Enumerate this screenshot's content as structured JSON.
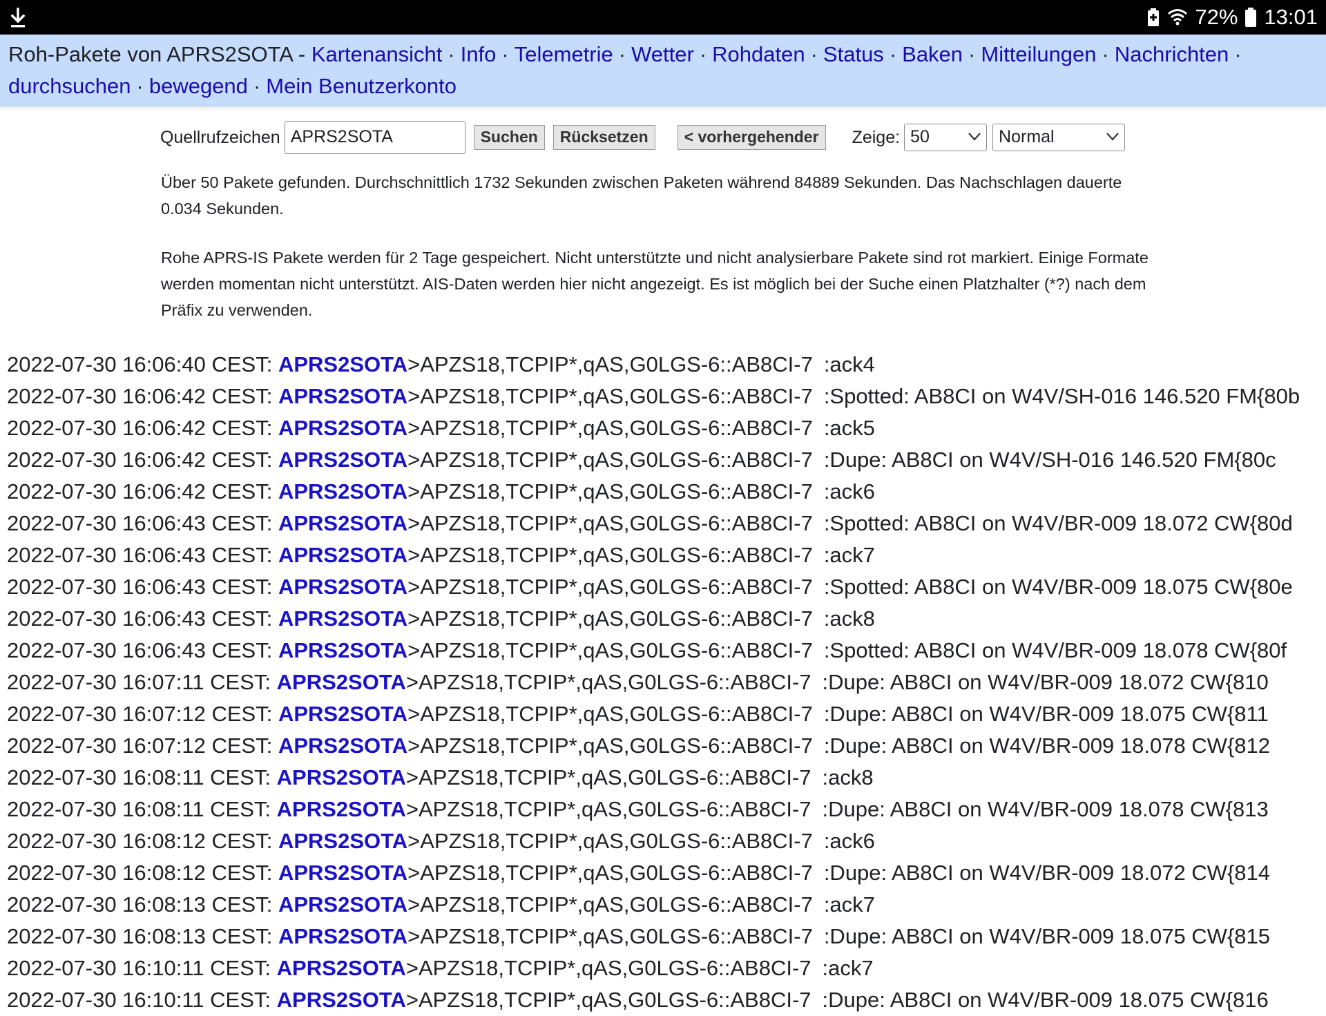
{
  "status_bar": {
    "download_icon": "download-icon",
    "battery_saver_icon": "battery-saver-icon",
    "wifi_icon": "wifi-icon",
    "battery_percent": "72%",
    "battery_icon": "battery-icon",
    "time": "13:01"
  },
  "nav": {
    "title": "Roh-Pakete von APRS2SOTA",
    "title_sep": " - ",
    "links": [
      "Kartenansicht",
      "Info",
      "Telemetrie",
      "Wetter",
      "Rohdaten",
      "Status",
      "Baken",
      "Mitteilungen",
      "Nachrichten",
      "durchsuchen",
      "bewegend",
      "Mein Benutzerkonto"
    ],
    "separator": "·"
  },
  "search": {
    "label": "Quellrufzeichen",
    "value": "APRS2SOTA",
    "search_button": "Suchen",
    "reset_button": "Rücksetzen",
    "previous_button": "< vorhergehender",
    "show_label": "Zeige:",
    "count_selected": "50",
    "mode_selected": "Normal"
  },
  "info": {
    "summary": "Über 50 Pakete gefunden. Durchschnittlich 1732 Sekunden zwischen Paketen während 84889 Sekunden. Das Nachschlagen dauerte 0.034 Sekunden.",
    "note": "Rohe APRS-IS Pakete werden für 2 Tage gespeichert. Nicht unterstützte und nicht analysierbare Pakete sind rot markiert. Einige Formate werden momentan nicht unterstützt. AIS-Daten werden hier nicht angezeigt. Es ist möglich bei der Suche einen Platzhalter (*?) nach dem Präfix zu verwenden."
  },
  "packets": [
    {
      "time": "2022-07-30 16:06:40 CEST:",
      "call": "APRS2SOTA",
      "path": ">APZS18,TCPIP*,qAS,G0LGS-6::AB8CI-7",
      "msg": ":ack4"
    },
    {
      "time": "2022-07-30 16:06:42 CEST:",
      "call": "APRS2SOTA",
      "path": ">APZS18,TCPIP*,qAS,G0LGS-6::AB8CI-7",
      "msg": ":Spotted: AB8CI on W4V/SH-016 146.520 FM{80b"
    },
    {
      "time": "2022-07-30 16:06:42 CEST:",
      "call": "APRS2SOTA",
      "path": ">APZS18,TCPIP*,qAS,G0LGS-6::AB8CI-7",
      "msg": ":ack5"
    },
    {
      "time": "2022-07-30 16:06:42 CEST:",
      "call": "APRS2SOTA",
      "path": ">APZS18,TCPIP*,qAS,G0LGS-6::AB8CI-7",
      "msg": ":Dupe: AB8CI on W4V/SH-016 146.520 FM{80c"
    },
    {
      "time": "2022-07-30 16:06:42 CEST:",
      "call": "APRS2SOTA",
      "path": ">APZS18,TCPIP*,qAS,G0LGS-6::AB8CI-7",
      "msg": ":ack6"
    },
    {
      "time": "2022-07-30 16:06:43 CEST:",
      "call": "APRS2SOTA",
      "path": ">APZS18,TCPIP*,qAS,G0LGS-6::AB8CI-7",
      "msg": ":Spotted: AB8CI on W4V/BR-009 18.072 CW{80d"
    },
    {
      "time": "2022-07-30 16:06:43 CEST:",
      "call": "APRS2SOTA",
      "path": ">APZS18,TCPIP*,qAS,G0LGS-6::AB8CI-7",
      "msg": ":ack7"
    },
    {
      "time": "2022-07-30 16:06:43 CEST:",
      "call": "APRS2SOTA",
      "path": ">APZS18,TCPIP*,qAS,G0LGS-6::AB8CI-7",
      "msg": ":Spotted: AB8CI on W4V/BR-009 18.075 CW{80e"
    },
    {
      "time": "2022-07-30 16:06:43 CEST:",
      "call": "APRS2SOTA",
      "path": ">APZS18,TCPIP*,qAS,G0LGS-6::AB8CI-7",
      "msg": ":ack8"
    },
    {
      "time": "2022-07-30 16:06:43 CEST:",
      "call": "APRS2SOTA",
      "path": ">APZS18,TCPIP*,qAS,G0LGS-6::AB8CI-7",
      "msg": ":Spotted: AB8CI on W4V/BR-009 18.078 CW{80f"
    },
    {
      "time": "2022-07-30 16:07:11 CEST:",
      "call": "APRS2SOTA",
      "path": ">APZS18,TCPIP*,qAS,G0LGS-6::AB8CI-7",
      "msg": ":Dupe: AB8CI on W4V/BR-009 18.072 CW{810"
    },
    {
      "time": "2022-07-30 16:07:12 CEST:",
      "call": "APRS2SOTA",
      "path": ">APZS18,TCPIP*,qAS,G0LGS-6::AB8CI-7",
      "msg": ":Dupe: AB8CI on W4V/BR-009 18.075 CW{811"
    },
    {
      "time": "2022-07-30 16:07:12 CEST:",
      "call": "APRS2SOTA",
      "path": ">APZS18,TCPIP*,qAS,G0LGS-6::AB8CI-7",
      "msg": ":Dupe: AB8CI on W4V/BR-009 18.078 CW{812"
    },
    {
      "time": "2022-07-30 16:08:11 CEST:",
      "call": "APRS2SOTA",
      "path": ">APZS18,TCPIP*,qAS,G0LGS-6::AB8CI-7",
      "msg": ":ack8"
    },
    {
      "time": "2022-07-30 16:08:11 CEST:",
      "call": "APRS2SOTA",
      "path": ">APZS18,TCPIP*,qAS,G0LGS-6::AB8CI-7",
      "msg": ":Dupe: AB8CI on W4V/BR-009 18.078 CW{813"
    },
    {
      "time": "2022-07-30 16:08:12 CEST:",
      "call": "APRS2SOTA",
      "path": ">APZS18,TCPIP*,qAS,G0LGS-6::AB8CI-7",
      "msg": ":ack6"
    },
    {
      "time": "2022-07-30 16:08:12 CEST:",
      "call": "APRS2SOTA",
      "path": ">APZS18,TCPIP*,qAS,G0LGS-6::AB8CI-7",
      "msg": ":Dupe: AB8CI on W4V/BR-009 18.072 CW{814"
    },
    {
      "time": "2022-07-30 16:08:13 CEST:",
      "call": "APRS2SOTA",
      "path": ">APZS18,TCPIP*,qAS,G0LGS-6::AB8CI-7",
      "msg": ":ack7"
    },
    {
      "time": "2022-07-30 16:08:13 CEST:",
      "call": "APRS2SOTA",
      "path": ">APZS18,TCPIP*,qAS,G0LGS-6::AB8CI-7",
      "msg": ":Dupe: AB8CI on W4V/BR-009 18.075 CW{815"
    },
    {
      "time": "2022-07-30 16:10:11 CEST:",
      "call": "APRS2SOTA",
      "path": ">APZS18,TCPIP*,qAS,G0LGS-6::AB8CI-7",
      "msg": ":ack7"
    },
    {
      "time": "2022-07-30 16:10:11 CEST:",
      "call": "APRS2SOTA",
      "path": ">APZS18,TCPIP*,qAS,G0LGS-6::AB8CI-7",
      "msg": ":Dupe: AB8CI on W4V/BR-009 18.075 CW{816"
    }
  ],
  "colors": {
    "nav_background": "#c6dcfd",
    "link": "#1a0dab",
    "callsign": "#1a12c8",
    "status_bar": "#000000"
  }
}
